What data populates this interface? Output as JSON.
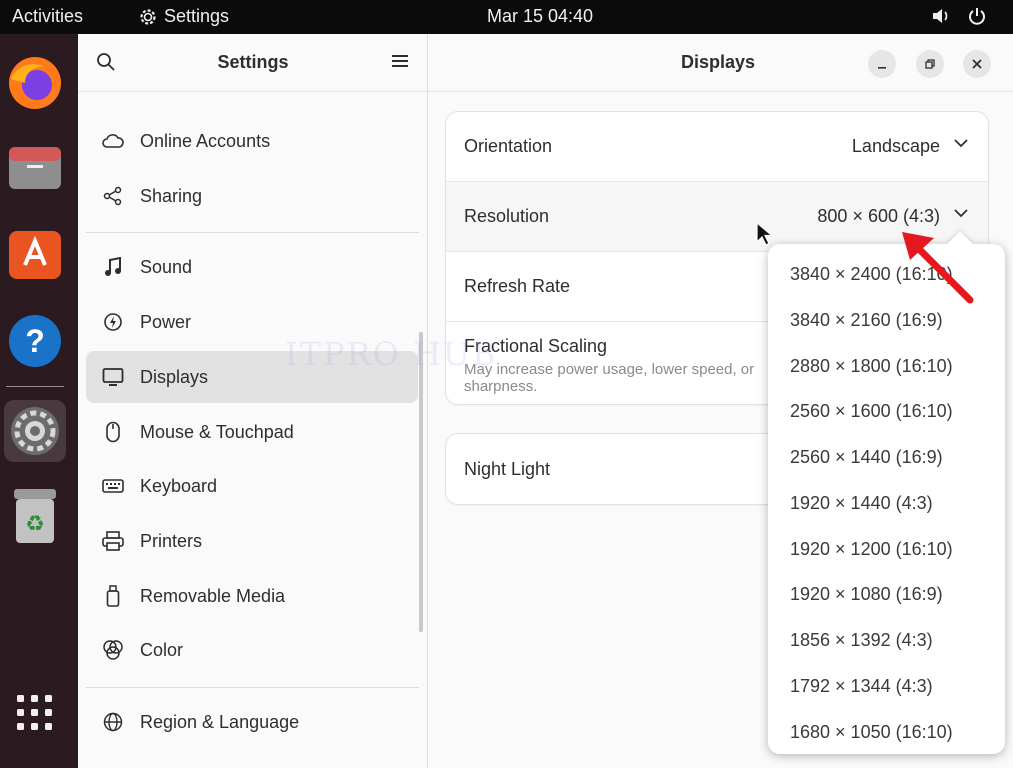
{
  "topbar": {
    "activities": "Activities",
    "app_name": "Settings",
    "clock": "Mar 15  04:40"
  },
  "dock": {
    "items": [
      {
        "name": "firefox-icon",
        "active": false
      },
      {
        "name": "files-icon",
        "active": false
      },
      {
        "name": "app-center-icon",
        "active": false
      },
      {
        "name": "help-icon",
        "active": false
      },
      {
        "name": "settings-icon",
        "active": true
      },
      {
        "name": "trash-icon",
        "active": false
      },
      {
        "name": "app-grid-icon",
        "active": false
      }
    ]
  },
  "sidebar": {
    "title": "Settings",
    "items": [
      {
        "label": "Online Accounts",
        "icon": "cloud-icon"
      },
      {
        "label": "Sharing",
        "icon": "share-icon"
      },
      {
        "label": "Sound",
        "icon": "music-note-icon"
      },
      {
        "label": "Power",
        "icon": "power-icon"
      },
      {
        "label": "Displays",
        "icon": "monitor-icon",
        "selected": true
      },
      {
        "label": "Mouse & Touchpad",
        "icon": "mouse-icon"
      },
      {
        "label": "Keyboard",
        "icon": "keyboard-icon"
      },
      {
        "label": "Printers",
        "icon": "printer-icon"
      },
      {
        "label": "Removable Media",
        "icon": "usb-drive-icon"
      },
      {
        "label": "Color",
        "icon": "color-icon"
      },
      {
        "label": "Region & Language",
        "icon": "globe-icon"
      }
    ]
  },
  "main": {
    "title": "Displays",
    "rows": [
      {
        "label": "Orientation",
        "value": "Landscape"
      },
      {
        "label": "Resolution",
        "value": "800 × 600 (4:3)"
      },
      {
        "label": "Refresh Rate"
      },
      {
        "label": "Fractional Scaling",
        "sub": "May increase power usage, lower speed, or sharpness."
      }
    ],
    "night_light": "Night Light"
  },
  "watermark": "ITPRO HUB",
  "resolution_options": [
    "3840 × 2400 (16:10)",
    "3840 × 2160 (16:9)",
    "2880 × 1800 (16:10)",
    "2560 × 1600 (16:10)",
    "2560 × 1440 (16:9)",
    "1920 × 1440 (4:3)",
    "1920 × 1200 (16:10)",
    "1920 × 1080 (16:9)",
    "1856 × 1392 (4:3)",
    "1792 × 1344 (4:3)",
    "1680 × 1050 (16:10)"
  ],
  "colors": {
    "accent_arrow": "#e4181f",
    "dock_bg": "#2b1a1f",
    "topbar_bg": "#0b0b0b"
  }
}
